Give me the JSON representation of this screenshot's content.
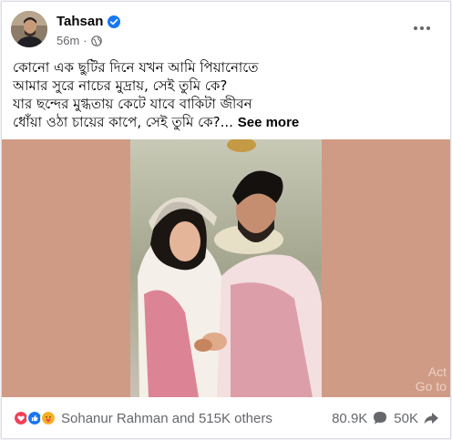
{
  "post": {
    "author": "Tahsan",
    "time": "56m",
    "text_lines": [
      "কোনো এক ছুটির দিনে যখন আমি পিয়ানোতে",
      "আমার সুরে নাচের মুদ্রায়, সেই তুমি কে?",
      "যার ছন্দের মুগ্ধতায় কেটে যাবে বাকিটা জীবন",
      "ধোঁয়া ওঠা চায়ের কাপে, সেই তুমি কে?..."
    ],
    "see_more": "See more",
    "watermark": [
      "Act",
      "Go to"
    ]
  },
  "reactions": {
    "summary": "Sohanur Rahman and 515K others",
    "icons": [
      "heart-react-icon",
      "like-react-icon",
      "care-react-icon"
    ],
    "comments": "80.9K",
    "shares": "50K"
  },
  "colors": {
    "media_bg": "#d09b84",
    "verified": "#1877f2",
    "heart": "#f33e58",
    "like": "#1877f2",
    "care": "#f7b125"
  },
  "icons": {
    "verified": "verified-badge-icon",
    "audience": "globe-icon",
    "more": "more-options-icon",
    "comment": "comment-icon",
    "share": "share-icon"
  }
}
